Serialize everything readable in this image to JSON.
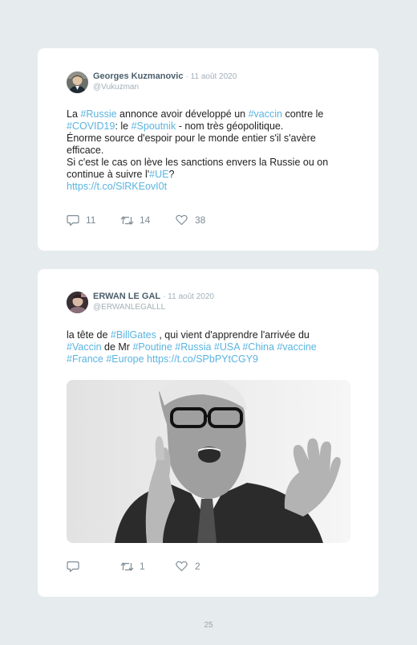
{
  "tweets": [
    {
      "name": "Georges Kuzmanovic",
      "date": "· 11 août 2020",
      "handle": "@Vukuzman",
      "lines": [
        [
          {
            "t": "La "
          },
          {
            "t": "#Russie",
            "tag": true
          },
          {
            "t": " annonce avoir développé un "
          },
          {
            "t": "#vaccin",
            "tag": true
          },
          {
            "t": " contre le"
          }
        ],
        [
          {
            "t": "#COVID19",
            "tag": true
          },
          {
            "t": ": le "
          },
          {
            "t": "#Spoutnik",
            "tag": true
          },
          {
            "t": " - nom très géopolitique."
          }
        ],
        [
          {
            "t": "Énorme source d'espoir pour le monde entier s'il s'avère"
          }
        ],
        [
          {
            "t": "efficace."
          }
        ],
        [
          {
            "t": "Si c'est le cas on lève les sanctions envers la Russie ou on"
          }
        ],
        [
          {
            "t": "continue à suivre l'"
          },
          {
            "t": "#UE",
            "tag": true
          },
          {
            "t": "?"
          }
        ],
        [
          {
            "t": "https://t.co/SlRKEovI0t",
            "tag": true
          }
        ]
      ],
      "replies": "11",
      "retweets": "14",
      "likes": "38"
    },
    {
      "name": "ERWAN LE GAL",
      "date": "· 11 août 2020",
      "handle": "@ERWANLEGALLL",
      "lines": [
        [
          {
            "t": "la tête de "
          },
          {
            "t": "#BillGates",
            "tag": true
          },
          {
            "t": " , qui vient d'apprendre l'arrivée du"
          }
        ],
        [
          {
            "t": "#Vaccin",
            "tag": true
          },
          {
            "t": " de Mr "
          },
          {
            "t": "#Poutine #Russia #USA #China #vaccine",
            "tag": true
          }
        ],
        [
          {
            "t": "#France #Europe https://t.co/SPbPYtCGY9",
            "tag": true
          }
        ]
      ],
      "replies": "",
      "retweets": "1",
      "likes": "2"
    }
  ],
  "page_number": "25",
  "colors": {
    "hashtag": "#5ab4e0",
    "background": "#e6ebed",
    "card": "#ffffff"
  },
  "icons": {
    "reply": "reply-icon",
    "retweet": "retweet-icon",
    "like": "heart-icon"
  }
}
